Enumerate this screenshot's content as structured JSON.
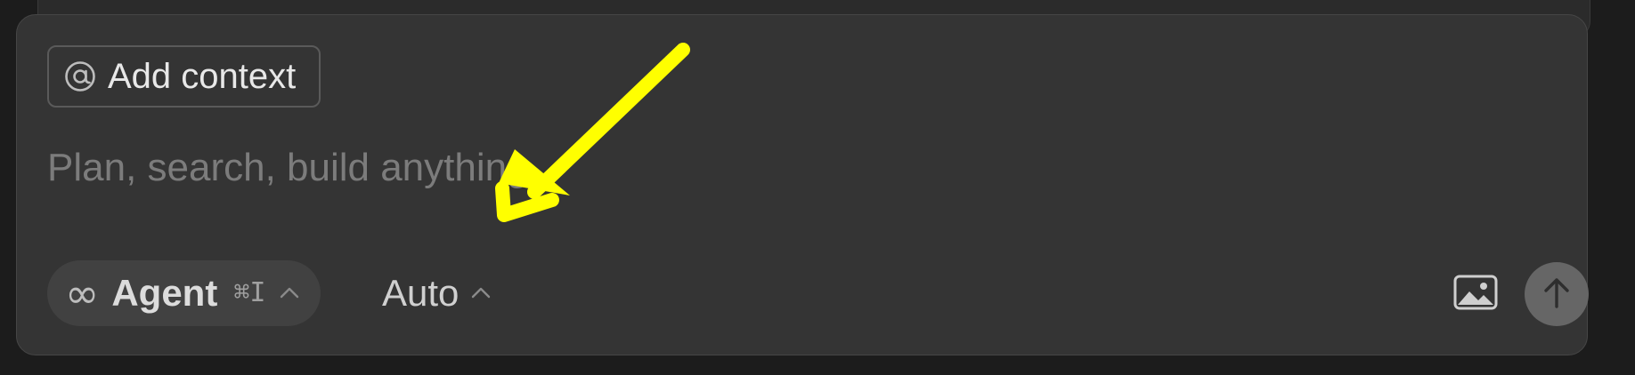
{
  "composer": {
    "context_button": {
      "label": "Add context",
      "icon": "at-icon"
    },
    "prompt": {
      "placeholder": "Plan, search, build anything",
      "value": ""
    },
    "mode_selector": {
      "icon": "infinity-icon",
      "label": "Agent",
      "shortcut": "⌘I"
    },
    "model_selector": {
      "label": "Auto"
    },
    "image_button": {
      "icon": "image-icon"
    },
    "send_button": {
      "icon": "arrow-up-icon"
    }
  },
  "colors": {
    "page_background": "#1c1c1c",
    "composer_background": "#343434",
    "annotation_arrow": "#ffff00"
  }
}
